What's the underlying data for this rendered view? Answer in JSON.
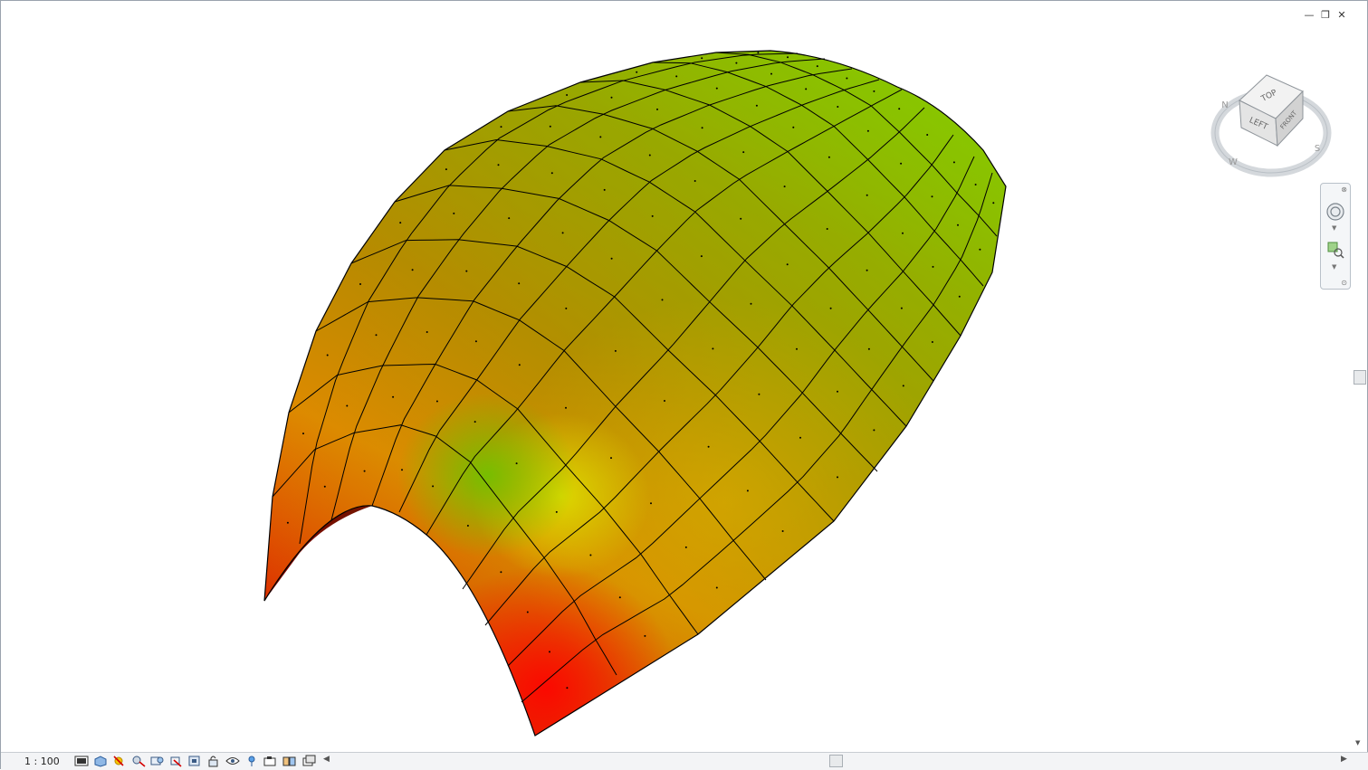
{
  "window_controls": {
    "minimize_glyph": "—",
    "restore_glyph": "❐",
    "close_glyph": "✕"
  },
  "viewcube": {
    "top_label": "TOP",
    "left_label": "LEFT",
    "front_label": "FRONT",
    "compass_labels": [
      "N",
      "W",
      "S"
    ]
  },
  "navigation_bar": {
    "icons": [
      "steering-wheel-icon",
      "zoom-region-icon"
    ]
  },
  "status_bar": {
    "scale": "1 : 100",
    "icons": [
      "detail-level-icon",
      "visual-style-icon",
      "sun-path-icon",
      "shadows-icon",
      "rendering-icon",
      "crop-view-icon",
      "show-crop-region-icon",
      "unlock-3d-view-icon",
      "temporary-hide-icon",
      "reveal-hidden-icon",
      "analysis-display-icon",
      "highlight-displacement-icon",
      "reveal-constraints-icon",
      "worksharing-icon"
    ]
  },
  "surface": {
    "colors": {
      "red": "#e60000",
      "dark_red": "#6e0000",
      "orange": "#ff9a00",
      "amber": "#c97a00",
      "brown": "#8a4a00",
      "yellow": "#d6dc00",
      "green": "#7cc200",
      "lime": "#a8d000",
      "grid_line": "#000000"
    }
  }
}
